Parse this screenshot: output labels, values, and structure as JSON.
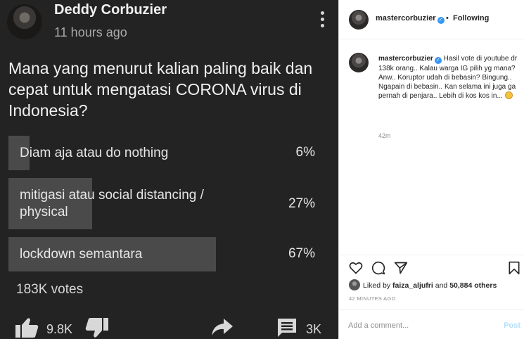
{
  "youtube": {
    "author": "Deddy Corbuzier",
    "time": "11 hours ago",
    "question": "Mana yang menurut kalian paling baik dan cepat untuk mengatasi CORONA virus di Indonesia?",
    "options": [
      {
        "label": "Diam aja atau do nothing",
        "percent": "6%",
        "fill": 0.06
      },
      {
        "label": "mitigasi atau social distancing / physical",
        "percent": "27%",
        "fill": 0.27
      },
      {
        "label": "lockdown semantara",
        "percent": "67%",
        "fill": 0.67
      }
    ],
    "votes": "183K votes",
    "like_count": "9.8K",
    "comment_count": "3K",
    "icons": [
      "more-vert-icon",
      "thumbs-up-icon",
      "thumbs-down-icon",
      "share-icon",
      "comment-icon"
    ],
    "colors": {
      "background": "#232323",
      "poll_fill": "#4a4a4a",
      "text": "#f1f1f1"
    }
  },
  "instagram": {
    "username": "mastercorbuzier",
    "separator": "•",
    "following": "Following",
    "caption_user": "mastercorbuzier",
    "caption": "Hasil vote di youtube dr 138k orang.. Kalau warga IG pilih yg mana? Anw.. Koruptor udah di bebasin? Bingung.. Ngapain di bebasin.. Kan selama ini juga ga pernah di penjara.. Lebih di kos kos in...",
    "caption_time": "42m",
    "liked_by_prefix": "Liked by",
    "liked_by_user": "faiza_aljufri",
    "liked_by_and": "and",
    "liked_by_others": "50,884 others",
    "post_date": "42 MINUTES AGO",
    "comment_placeholder": "Add a comment...",
    "post_label": "Post",
    "icons": [
      "verified-icon",
      "heart-icon",
      "comment-bubble-icon",
      "send-icon",
      "bookmark-icon",
      "grinning-emoji-icon"
    ],
    "colors": {
      "verified": "#3897f0",
      "post_button": "#b2dffc",
      "muted": "#8e8e8e"
    }
  }
}
